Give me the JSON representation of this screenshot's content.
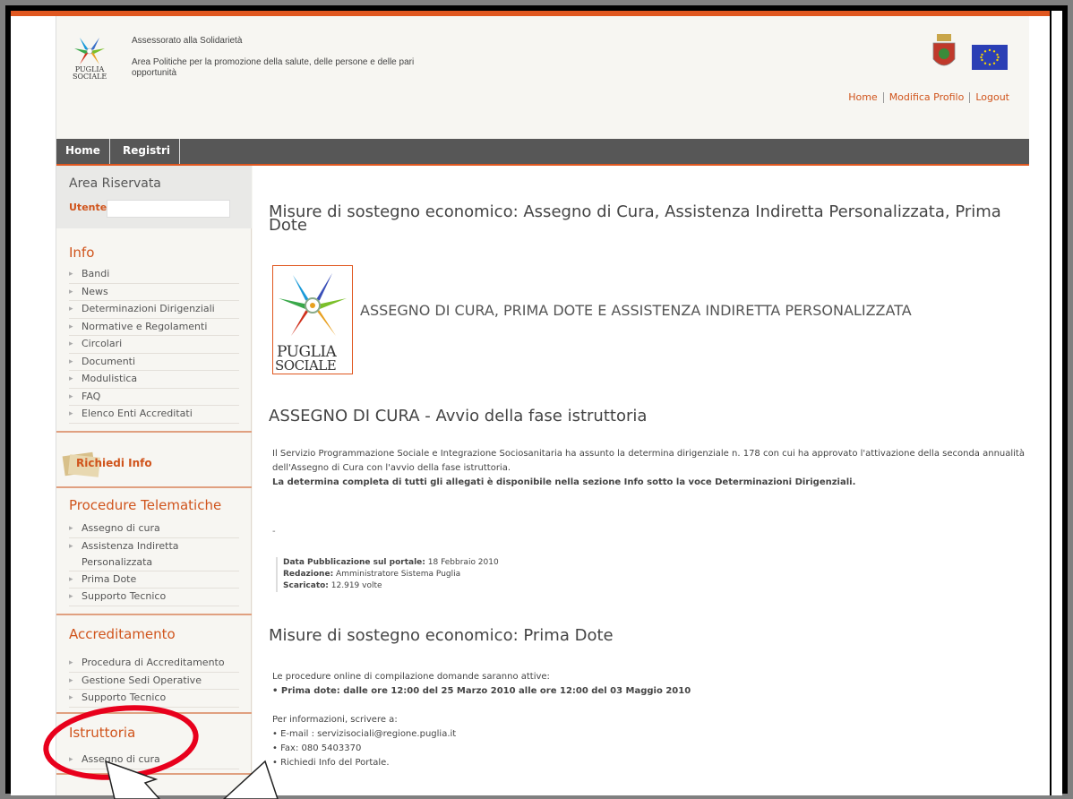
{
  "header": {
    "logo_caption_1": "PUGLIA",
    "logo_caption_2": "SOCIALE",
    "line1": "Assessorato alla Solidarietà",
    "line2": "Area Politiche per la promozione della salute, delle persone e delle pari opportunità",
    "links": [
      "Home",
      "Modifica Profilo",
      "Logout"
    ]
  },
  "nav": {
    "items": [
      "Home",
      "Registri"
    ]
  },
  "sidebar": {
    "area_title": "Area Riservata",
    "utente_label": "Utente:",
    "utente_value": "",
    "info_title": "Info",
    "info_items": [
      "Bandi",
      "News",
      "Determinazioni Dirigenziali",
      "Normative e Regolamenti",
      "Circolari",
      "Documenti",
      "Modulistica",
      "FAQ",
      "Elenco Enti Accreditati"
    ],
    "richiedi_info": "Richiedi Info",
    "procedure_title": "Procedure Telematiche",
    "procedure_items": [
      "Assegno di cura",
      "Assistenza Indiretta Personalizzata",
      "Prima Dote",
      "Supporto Tecnico"
    ],
    "accreditamento_title": "Accreditamento",
    "accreditamento_items": [
      "Procedura di Accreditamento",
      "Gestione Sedi Operative",
      "Supporto Tecnico"
    ],
    "istruttoria_title": "Istruttoria",
    "istruttoria_items": [
      "Assegno di cura"
    ]
  },
  "main": {
    "title": "Misure di sostegno economico: Assegno di Cura, Assistenza Indiretta Personalizzata, Prima Dote",
    "logo_line1": "PUGLIA",
    "logo_line2": "SOCIALE",
    "banner": "ASSEGNO DI CURA, PRIMA DOTE E ASSISTENZA INDIRETTA PERSONALIZZATA",
    "assegno_heading": "ASSEGNO DI CURA - Avvio della fase istruttoria",
    "assegno_text": "Il Servizio Programmazione Sociale e Integrazione Sociosanitaria ha assunto la determina dirigenziale n. 178 con cui ha approvato l'attivazione della seconda annualità dell'Assegno di Cura con l'avvio della fase istruttoria.",
    "assegno_bold": "La determina completa di tutti gli allegati è disponibile nella sezione Info sotto la voce Determinazioni Dirigenziali.",
    "dash": "-",
    "meta": {
      "pub_label": "Data Pubblicazione sul portale:",
      "pub_value": "18 Febbraio 2010",
      "red_label": "Redazione:",
      "red_value": "Amministratore Sistema Puglia",
      "down_label": "Scaricato:",
      "down_value": "12.919 volte"
    },
    "prima_heading": "Misure di sostegno economico: Prima Dote",
    "proc_text": "Le procedure online di compilazione domande saranno attive:",
    "proc_item": "Prima dote: dalle ore 12:00 del 25 Marzo 2010 alle ore 12:00 del 03 Maggio 2010",
    "info_text": "Per informazioni, scrivere a:",
    "info_items": [
      "E-mail : servizisociali@regione.puglia.it",
      "Fax: 080 5403370",
      "Richiedi Info del Portale."
    ]
  },
  "colors": {
    "accent": "#e0571f",
    "nav_bg": "#575757",
    "annotation": "#e8001c"
  }
}
